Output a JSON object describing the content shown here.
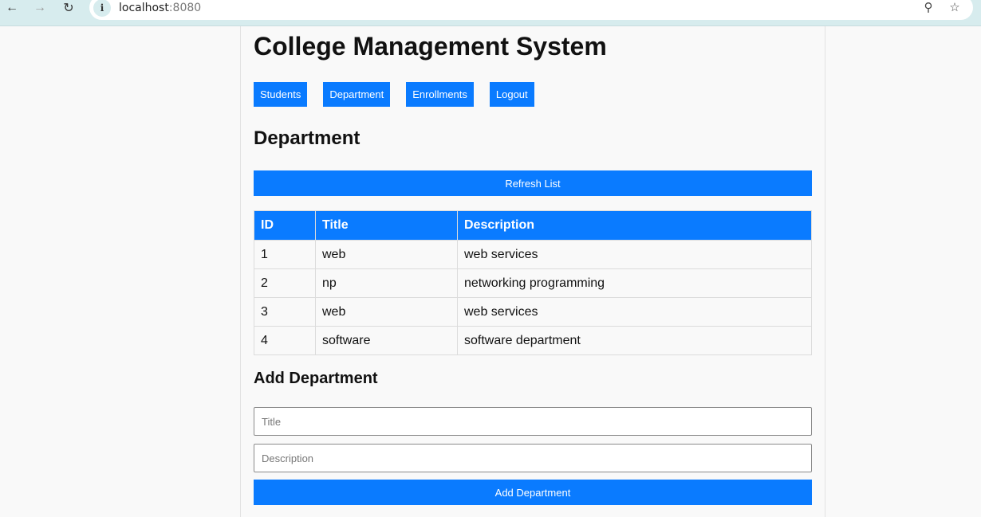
{
  "browser": {
    "url_host": "localhost",
    "url_port": ":8080"
  },
  "page": {
    "title": "College Management System"
  },
  "nav": {
    "items": [
      "Students",
      "Department",
      "Enrollments",
      "Logout"
    ]
  },
  "department": {
    "heading": "Department",
    "refresh_label": "Refresh List",
    "table": {
      "headers": [
        "ID",
        "Title",
        "Description"
      ],
      "rows": [
        [
          "1",
          "web",
          "web services"
        ],
        [
          "2",
          "np",
          "networking programming"
        ],
        [
          "3",
          "web",
          "web services"
        ],
        [
          "4",
          "software",
          "software department"
        ]
      ]
    }
  },
  "add_form": {
    "heading": "Add Department",
    "title_placeholder": "Title",
    "description_placeholder": "Description",
    "submit_label": "Add Department"
  },
  "colors": {
    "accent": "#0a7bff",
    "chrome": "#d7ecee"
  },
  "icons": [
    "back-arrow-icon",
    "forward-arrow-icon",
    "reload-icon",
    "info-icon",
    "key-icon",
    "star-icon"
  ]
}
